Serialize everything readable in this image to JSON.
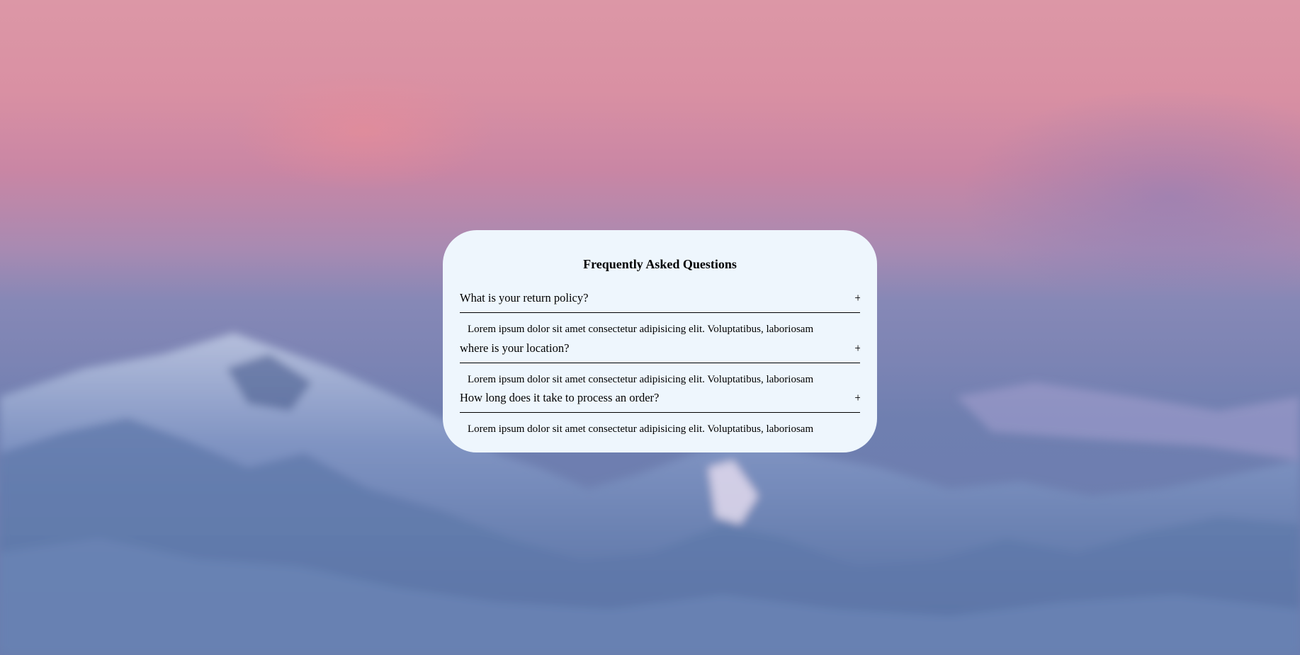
{
  "faq": {
    "title": "Frequently Asked Questions",
    "items": [
      {
        "question": "What is your return policy?",
        "toggle": "+",
        "answer": "Lorem ipsum dolor sit amet consectetur adipisicing elit. Voluptatibus, laboriosam"
      },
      {
        "question": "where is your location?",
        "toggle": "+",
        "answer": "Lorem ipsum dolor sit amet consectetur adipisicing elit. Voluptatibus, laboriosam"
      },
      {
        "question": "How long does it take to process an order?",
        "toggle": "+",
        "answer": "Lorem ipsum dolor sit amet consectetur adipisicing elit. Voluptatibus, laboriosam"
      }
    ]
  },
  "colors": {
    "card_background": "#eef6fd",
    "sky_top": "#dc97a6",
    "mountain": "#4f6a9c"
  }
}
